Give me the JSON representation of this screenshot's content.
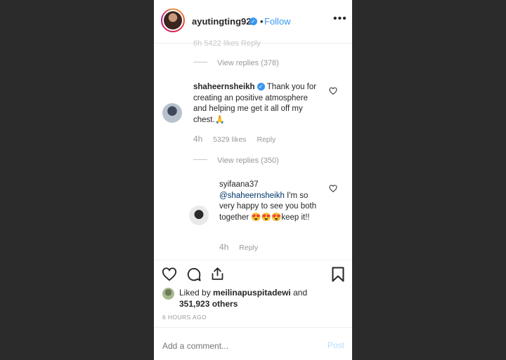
{
  "header": {
    "username": "ayutingting92",
    "separator": "•",
    "follow_label": "Follow",
    "more_label": "•••"
  },
  "thread": {
    "cut_off_text": "6h      5422 likes      Reply",
    "view_replies_1": "View replies (378)",
    "comment1": {
      "username": "shaheernsheikh",
      "text": "Thank you for creating an positive atmosphere and helping me get it all off my chest.🙏",
      "time": "4h",
      "likes": "5329 likes",
      "reply_label": "Reply"
    },
    "view_replies_2": "View replies (350)",
    "comment2": {
      "username": "syifaana37",
      "mention": "@shaheernsheikh",
      "text": "I'm so very happy to see you both together 😍😍😍keep it!!",
      "time": "4h",
      "reply_label": "Reply"
    }
  },
  "likes": {
    "prefix": "Liked by",
    "user": "meilinapuspitadewi",
    "conjunction": "and",
    "others": "351,923 others"
  },
  "time_ago": "6 HOURS AGO",
  "comment_box": {
    "placeholder": "Add a comment...",
    "post_label": "Post"
  }
}
